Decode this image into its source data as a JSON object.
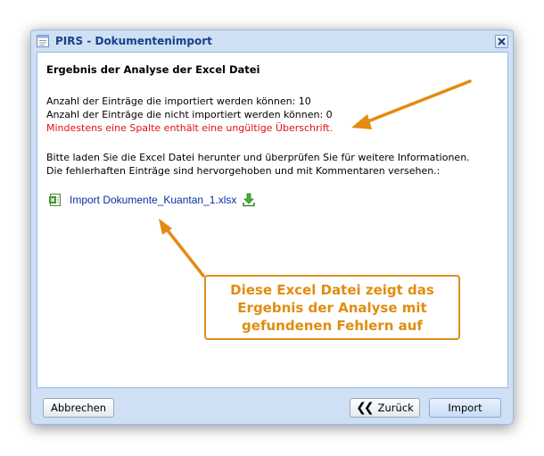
{
  "window": {
    "title": "PIRS - Dokumentenimport"
  },
  "content": {
    "heading": "Ergebnis der Analyse der Excel Datei",
    "importable": "Anzahl der Einträge die importiert werden können: 10",
    "not_importable": "Anzahl der Einträge die nicht importiert werden können: 0",
    "error_message": "Mindestens eine Spalte enthält eine ungültige Überschrift.",
    "instruction_1": "Bitte laden Sie die Excel Datei herunter und überprüfen Sie für weitere Informationen.",
    "instruction_2": "Die fehlerhaften Einträge sind hervorgehoben und mit Kommentaren versehen.:",
    "file_link": "Import Dokumente_Kuantan_1.xlsx"
  },
  "annotation": {
    "text": "Diese Excel Datei zeigt das\nErgebnis der Analyse mit\ngefundenen Fehlern auf"
  },
  "buttons": {
    "cancel": "Abbrechen",
    "back": "Zurück",
    "import": "Import"
  },
  "colors": {
    "error": "#e01010",
    "link": "#0b2ea6",
    "annotation": "#e08d10",
    "title": "#15428b"
  },
  "icons": {
    "title": "document-window-icon",
    "close": "close-icon",
    "file": "excel-file-icon",
    "download": "download-icon",
    "back": "double-chevron-left-icon"
  }
}
